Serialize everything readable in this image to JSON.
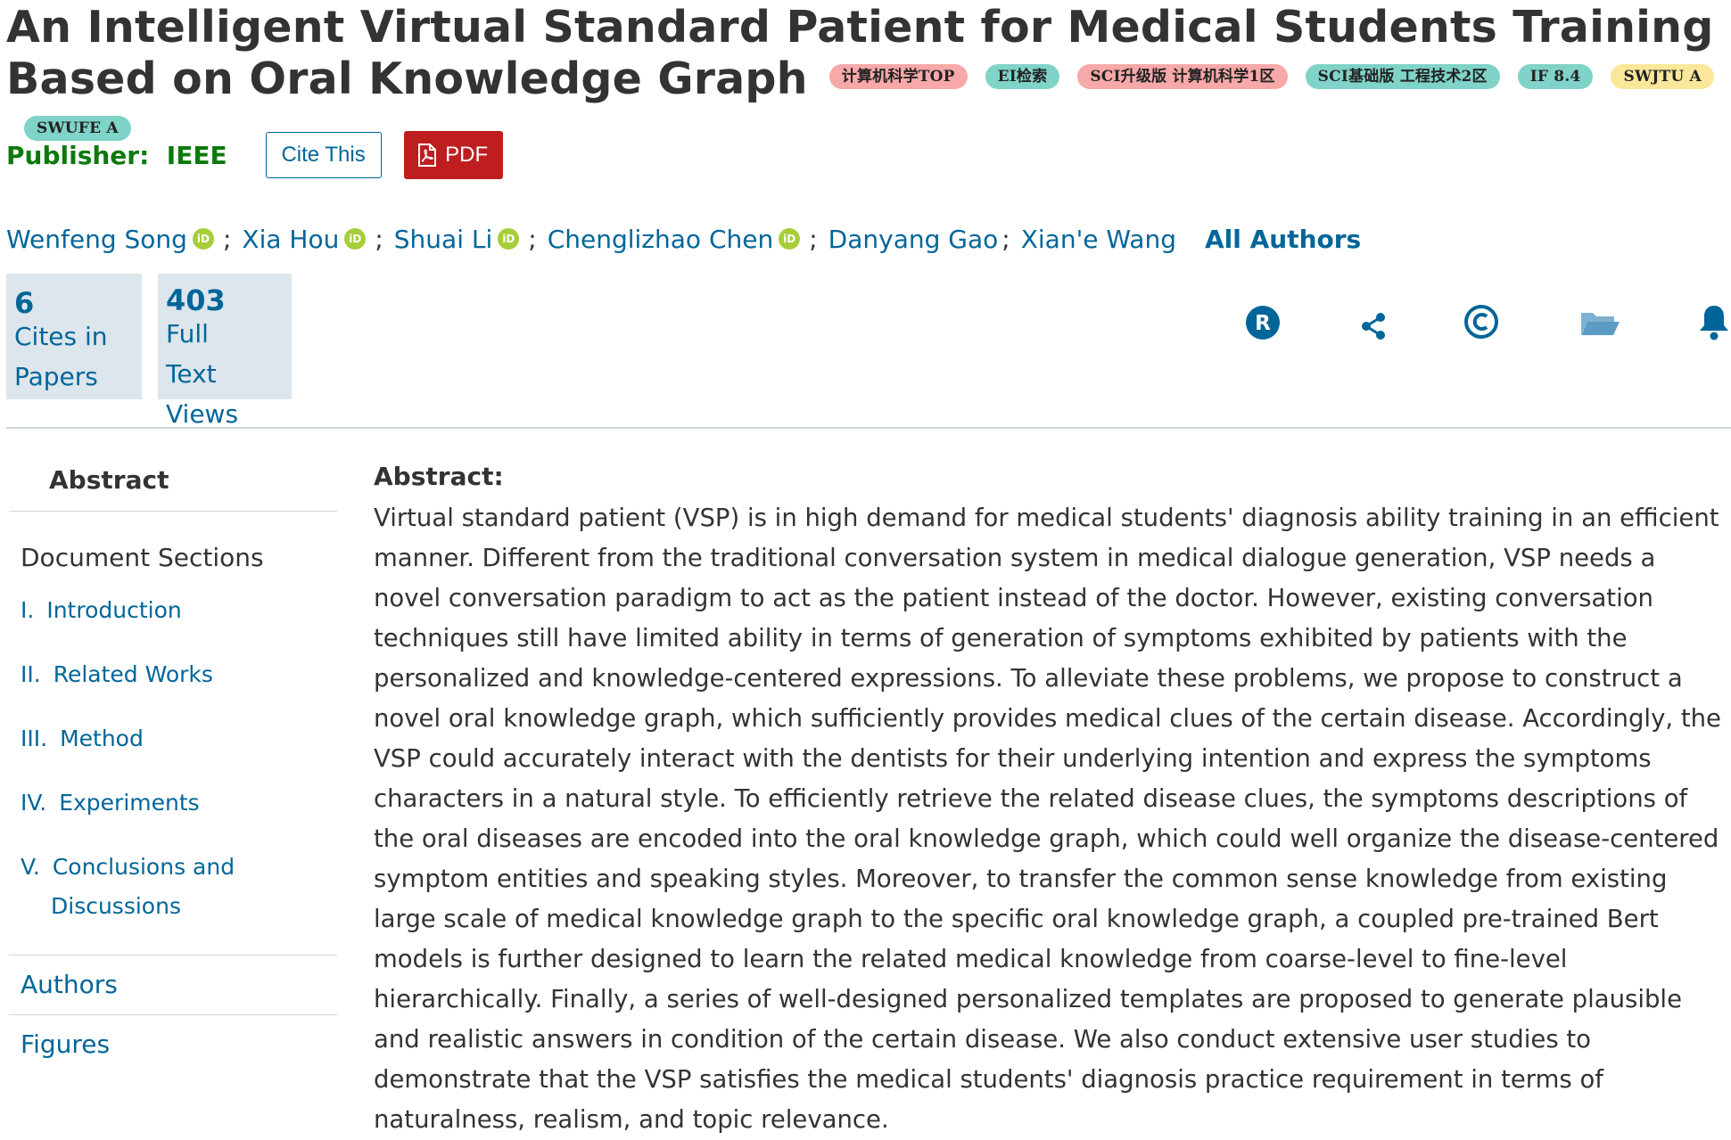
{
  "article": {
    "title": "An Intelligent Virtual Standard Patient for Medical Students Training Based on Oral Knowledge Graph",
    "badges": [
      {
        "label": "计算机科学TOP",
        "color": "#f7a8a8"
      },
      {
        "label": "EI检索",
        "color": "#7fd3c8"
      },
      {
        "label": "SCI升级版 计算机科学1区",
        "color": "#f7a8a8"
      },
      {
        "label": "SCI基础版 工程技术2区",
        "color": "#7fd3c8"
      },
      {
        "label": "IF 8.4",
        "color": "#7fd3c8"
      },
      {
        "label": "SWJTU A",
        "color": "#fbe79a"
      },
      {
        "label": "SWUFE A",
        "color": "#7fd3c8"
      }
    ],
    "publisher_label": "Publisher:",
    "publisher_name": "IEEE",
    "cite_label": "Cite This",
    "pdf_label": "PDF",
    "authors": [
      {
        "name": "Wenfeng Song",
        "orcid": true
      },
      {
        "name": "Xia Hou",
        "orcid": true
      },
      {
        "name": "Shuai Li",
        "orcid": true
      },
      {
        "name": "Chenglizhao Chen",
        "orcid": true
      },
      {
        "name": "Danyang Gao",
        "orcid": false
      },
      {
        "name": "Xian'e Wang",
        "orcid": false
      }
    ],
    "author_separator": ";",
    "all_authors_label": "All Authors",
    "orcid_icon_text": "iD"
  },
  "metrics": {
    "cites": {
      "value": "6",
      "line1": "Cites in",
      "line2": "Papers"
    },
    "views": {
      "value": "403",
      "line1": "Full",
      "line2": "Text",
      "line3": "Views"
    }
  },
  "action_icons": [
    "rights-r-icon",
    "share-icon",
    "copyright-icon",
    "folder-icon",
    "bell-icon"
  ],
  "sidebar": {
    "active": "Abstract",
    "doc_sections_label": "Document Sections",
    "sections": [
      {
        "num": "I.",
        "label": "Introduction"
      },
      {
        "num": "II.",
        "label": "Related Works"
      },
      {
        "num": "III.",
        "label": "Method"
      },
      {
        "num": "IV.",
        "label": "Experiments"
      },
      {
        "num": "V.",
        "label": "Conclusions and",
        "label2": "Discussions"
      }
    ],
    "links": [
      "Authors",
      "Figures"
    ]
  },
  "abstract": {
    "heading": "Abstract:",
    "text": "Virtual standard patient (VSP) is in high demand for medical students' diagnosis ability training in an efficient manner. Different from the traditional conversation system in medical dialogue generation, VSP needs a novel conversation paradigm to act as the patient instead of the doctor. However, existing conversation techniques still have limited ability in terms of generation of symptoms exhibited by patients with the personalized and knowledge-centered expressions. To alleviate these problems, we propose to construct a novel oral knowledge graph, which sufficiently provides medical clues of the certain disease. Accordingly, the VSP could accurately interact with the dentists for their underlying intention and express the symptoms characters in a natural style. To efficiently retrieve the related disease clues, the symptoms descriptions of the oral diseases are encoded into the oral knowledge graph, which could well organize the disease-centered symptom entities and speaking styles. Moreover, to transfer the common sense knowledge from existing large scale of medical knowledge graph to the specific oral knowledge graph, a coupled pre-trained Bert models is further designed to learn the related medical knowledge from coarse-level to fine-level hierarchically. Finally, a series of well-designed personalized templates are proposed to generate plausible and realistic answers in condition of the certain disease. We also conduct extensive user studies to demonstrate that the VSP satisfies the medical students' diagnosis practice requirement in terms of naturalness, realism, and topic relevance."
  },
  "colors": {
    "link": "#006699",
    "publisher": "#0b7a0b",
    "pdf": "#be1e1e",
    "metric_bg": "#dde6ec",
    "orcid": "#a6ce39"
  }
}
